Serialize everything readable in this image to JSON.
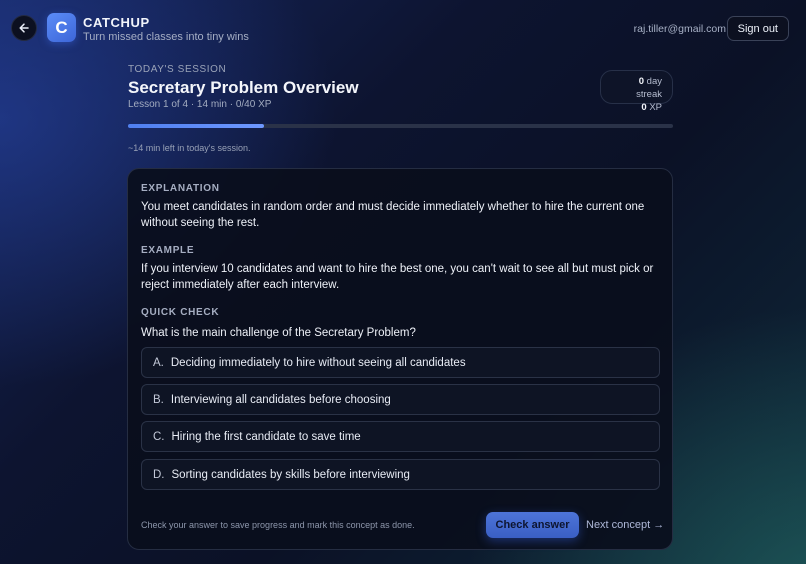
{
  "header": {
    "brand_initial": "C",
    "brand_title": "CATCHUP",
    "brand_subtitle": "Turn missed classes into tiny wins",
    "user_email": "raj.tiller@gmail.com",
    "sign_out_label": "Sign out"
  },
  "session": {
    "label": "TODAY'S SESSION",
    "title": "Secretary Problem Overview",
    "meta": "Lesson 1 of 4 · 14 min · 0/40 XP",
    "streak_value": "0",
    "streak_label": "day streak",
    "xp_value": "0",
    "xp_label": "XP",
    "progress_fraction": 0.25,
    "time_left": "~14 min left in today's session."
  },
  "card": {
    "explanation_label": "EXPLANATION",
    "explanation_text": "You meet candidates in random order and must decide immediately whether to hire the current one without seeing the rest.",
    "example_label": "EXAMPLE",
    "example_text": "If you interview 10 candidates and want to hire the best one, you can't wait to see all but must pick or reject immediately after each interview.",
    "quick_check_label": "QUICK CHECK",
    "question": "What is the main challenge of the Secretary Problem?",
    "options": [
      {
        "letter": "A.",
        "text": "Deciding immediately to hire without seeing all candidates"
      },
      {
        "letter": "B.",
        "text": "Interviewing all candidates before choosing"
      },
      {
        "letter": "C.",
        "text": "Hiring the first candidate to save time"
      },
      {
        "letter": "D.",
        "text": "Sorting candidates by skills before interviewing"
      }
    ],
    "footer_note": "Check your answer to save progress and mark this concept as done.",
    "check_label": "Check answer",
    "next_label": "Next concept →"
  },
  "colors": {
    "accent": "#4f7ff0",
    "background": "#0d1430"
  },
  "icons": {
    "back": "arrow-left-icon"
  }
}
